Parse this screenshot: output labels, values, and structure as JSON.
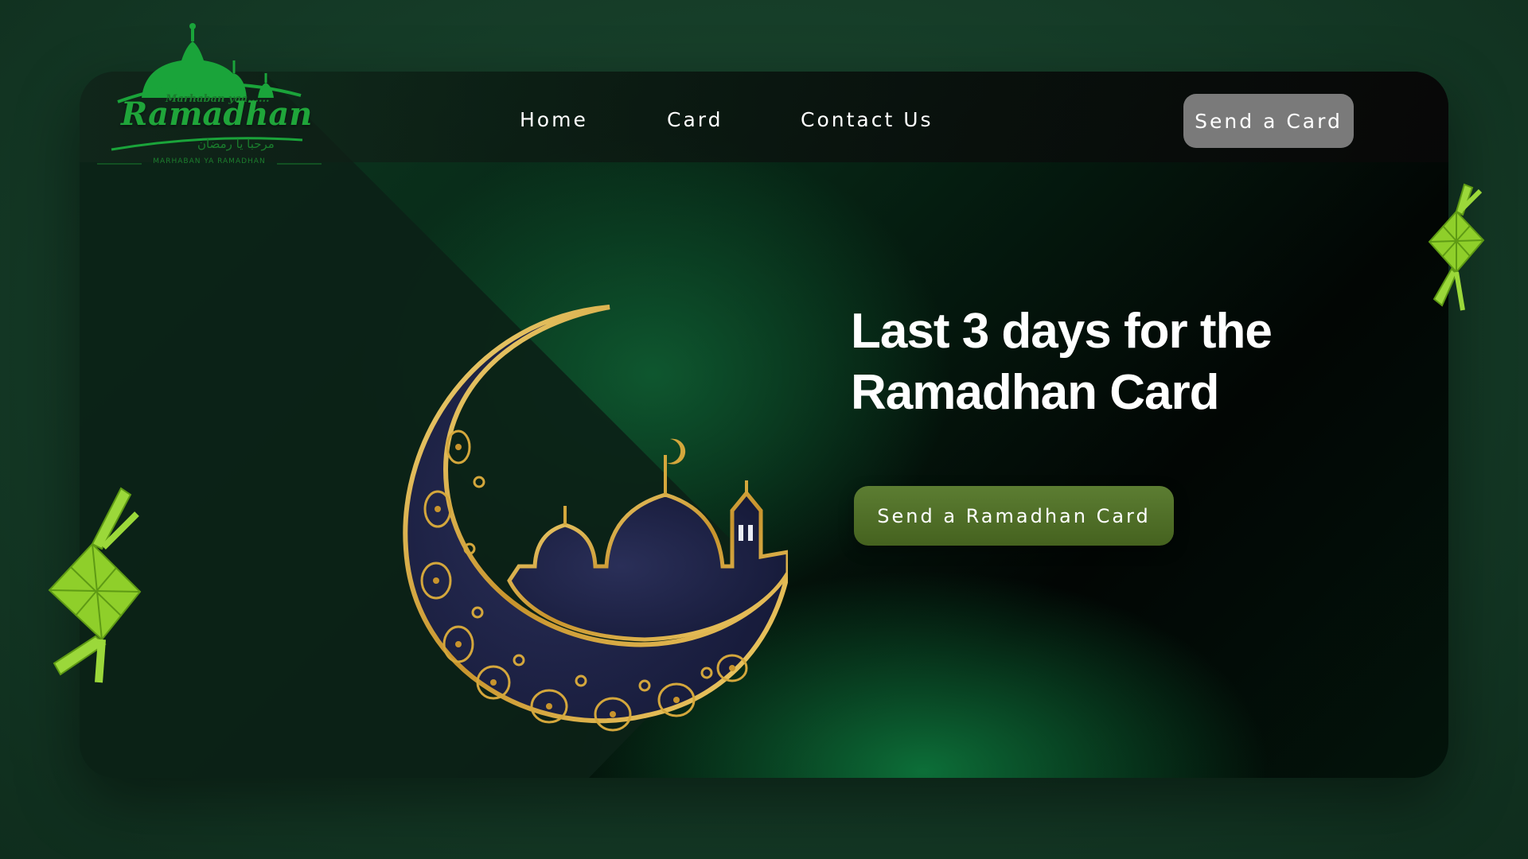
{
  "logo": {
    "small_text": "Marhaban yaa......",
    "title": "Ramadhan",
    "arabic": "مرحبا يا رمضان",
    "subtitle": "MARHABAN YA RAMADHAN"
  },
  "nav": {
    "items": [
      {
        "label": "Home"
      },
      {
        "label": "Card"
      },
      {
        "label": "Contact Us"
      }
    ],
    "button_label": "Send a Card"
  },
  "hero": {
    "headline_line1": "Last 3 days for the",
    "headline_line2": "Ramadhan Card",
    "cta_label": "Send a Ramadhan Card",
    "illustration": "crescent-moon-mosque-icon"
  },
  "decor": {
    "items": [
      "ketupat-icon",
      "ketupat-icon"
    ]
  },
  "colors": {
    "background": "#153b27",
    "accent_green": "#1fa53a",
    "cta": "#4f6e27",
    "nav_button": "#7a7a7a",
    "gold": "#d4a73c",
    "moon_navy": "#1b1f3f"
  }
}
